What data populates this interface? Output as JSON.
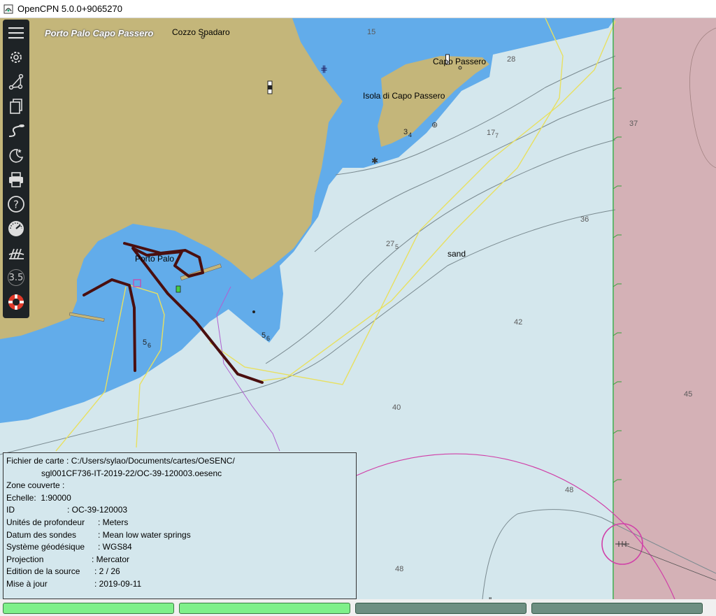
{
  "window": {
    "title": "OpenCPN 5.0.0+9065270"
  },
  "toolbar": {
    "items": [
      {
        "name": "menu",
        "icon": "hamburger-icon"
      },
      {
        "name": "settings",
        "icon": "gear-icon"
      },
      {
        "name": "route",
        "icon": "route-icon"
      },
      {
        "name": "route-manager",
        "icon": "documents-icon"
      },
      {
        "name": "track",
        "icon": "track-icon"
      },
      {
        "name": "color-scheme",
        "icon": "moon-star-icon"
      },
      {
        "name": "print",
        "icon": "printer-icon"
      },
      {
        "name": "help",
        "icon": "help-icon"
      },
      {
        "name": "dashboard",
        "icon": "gauge-icon"
      },
      {
        "name": "tides",
        "icon": "tide-icon"
      },
      {
        "name": "scale",
        "icon": "scale-icon",
        "label": "3.5"
      },
      {
        "name": "mob",
        "icon": "lifebuoy-icon"
      }
    ]
  },
  "chart": {
    "place_names": {
      "porto_palo_capo_passero": "Porto Palo Capo Passero",
      "cozzo_spadaro": "Cozzo Spadaro",
      "capo_passero": "Capo Passero",
      "isola": "Isola di Capo Passero",
      "porto_palo": "Porto Palo",
      "sand": "sand"
    },
    "soundings": {
      "s15": "15",
      "s28": "28",
      "s37": "37",
      "s17": "17",
      "s17b": "7",
      "s36": "36",
      "s27": "27",
      "s27b": "5",
      "s3": "3",
      "s3b": "4",
      "s42": "42",
      "s5a": "5",
      "s5ab": "6",
      "s5b": "5",
      "s5bb": "6",
      "s40": "40",
      "s45": "45",
      "s48a": "48",
      "s48b": "48"
    },
    "colors": {
      "land": "#c4b67a",
      "shallow": "#62acea",
      "deep": "#d4e7ed",
      "restricted": "#d4b1b6",
      "track": "#4a0f0f",
      "route": "#e8e060",
      "boundary": "#b060d0",
      "range_ring": "#d040a8",
      "green_line": "#36a03a"
    }
  },
  "info": {
    "fichier_label": "Fichier de carte :",
    "fichier_value": "C:/Users/sylao/Documents/cartes/OeSENC/",
    "fichier_value2": "sgl001CF736-IT-2019-22/OC-39-120003.oesenc",
    "zone_label": "Zone couverte  :",
    "echelle_label": "Echelle:",
    "echelle_value": "1:90000",
    "id_label": "ID",
    "id_value": ": OC-39-120003",
    "unites_label": "Unités de profondeur",
    "unites_value": ": Meters",
    "datum_label": "Datum des sondes",
    "datum_value": ": Mean low water springs",
    "systeme_label": "Système géodésique",
    "systeme_value": ": WGS84",
    "projection_label": "Projection",
    "projection_value": ": Mercator",
    "edition_label": "Edition de la source",
    "edition_value": ": 2 / 26",
    "miseajour_label": "Mise à jour",
    "miseajour_value": ": 2019-09-11"
  }
}
